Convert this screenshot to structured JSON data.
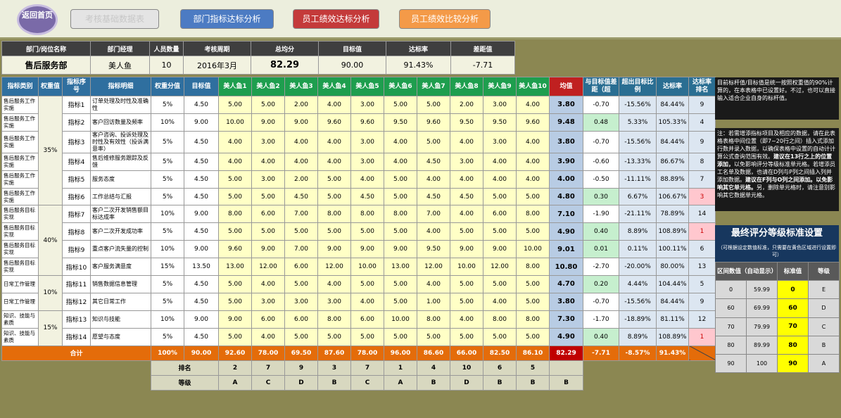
{
  "nav": {
    "home": "返回首页",
    "btn_base": "考核基础数据表",
    "btn_dept": "部门指标达标分析",
    "btn_staff": "员工绩效达标分析",
    "btn_compare": "员工绩效比较分析"
  },
  "summary": {
    "headers": [
      "部门/岗位名称",
      "部门经理",
      "人员数量",
      "考核周期",
      "总均分",
      "目标值",
      "达标率",
      "差距值"
    ],
    "values": [
      "售后服务部",
      "美人鱼",
      "10",
      "2016年3月",
      "82.29",
      "90.00",
      "91.43%",
      "-7.71"
    ]
  },
  "table": {
    "headers": [
      "指标类别",
      "权重值",
      "指标序号",
      "指标明细",
      "权重分值",
      "目标值",
      "美人鱼1",
      "美人鱼2",
      "美人鱼3",
      "美人鱼4",
      "美人鱼5",
      "美人鱼6",
      "美人鱼7",
      "美人鱼8",
      "美人鱼9",
      "美人鱼10",
      "均值",
      "与目标值差距（超",
      "超出目标比例",
      "达标率",
      "达标率排名"
    ],
    "rows": [
      {
        "cat": "售后服务工作实施",
        "no": "指标1",
        "detail": "订单处理及时性及准确性",
        "ws": "5%",
        "target": "4.50",
        "scores": [
          "5.00",
          "5.00",
          "2.00",
          "4.00",
          "3.00",
          "5.00",
          "5.00",
          "2.00",
          "3.00",
          "4.00"
        ],
        "avg": "3.80",
        "gap": "-0.70",
        "exceed": "-15.56%",
        "rate": "84.44%",
        "rank": "9"
      },
      {
        "cat": "售后服务工作实施",
        "no": "指标2",
        "detail": "客户回访数量及频率",
        "ws": "10%",
        "target": "9.00",
        "scores": [
          "10.00",
          "9.00",
          "9.00",
          "9.60",
          "9.60",
          "9.50",
          "9.60",
          "9.50",
          "9.50",
          "9.60"
        ],
        "avg": "9.48",
        "gap": "0.48",
        "exceed": "5.33%",
        "rate": "105.33%",
        "rank": "4"
      },
      {
        "cat": "售后服务工作实施",
        "no": "指标3",
        "detail": "客户咨询、投诉处理及时性及有效性（投诉满意率）",
        "ws": "5%",
        "target": "4.50",
        "scores": [
          "4.00",
          "3.00",
          "4.00",
          "4.00",
          "3.00",
          "4.00",
          "5.00",
          "4.00",
          "3.00",
          "4.00"
        ],
        "avg": "3.80",
        "gap": "-0.70",
        "exceed": "-15.56%",
        "rate": "84.44%",
        "rank": "9"
      },
      {
        "cat": "售后服务工作实施",
        "no": "指标4",
        "detail": "售后维修服务跟踪及反馈",
        "ws": "5%",
        "target": "4.50",
        "scores": [
          "4.00",
          "4.00",
          "4.00",
          "4.00",
          "3.00",
          "4.00",
          "4.50",
          "3.00",
          "4.00",
          "4.00"
        ],
        "avg": "3.90",
        "gap": "-0.60",
        "exceed": "-13.33%",
        "rate": "86.67%",
        "rank": "8"
      },
      {
        "cat": "售后服务工作实施",
        "no": "指标5",
        "detail": "服务态度",
        "ws": "5%",
        "target": "4.50",
        "scores": [
          "5.00",
          "3.00",
          "2.00",
          "5.00",
          "4.00",
          "5.00",
          "4.00",
          "4.00",
          "4.00",
          "4.00"
        ],
        "avg": "4.00",
        "gap": "-0.50",
        "exceed": "-11.11%",
        "rate": "88.89%",
        "rank": "7"
      },
      {
        "cat": "售后服务工作实施",
        "no": "指标6",
        "detail": "工作总结与汇报",
        "ws": "5%",
        "target": "4.50",
        "scores": [
          "5.00",
          "5.00",
          "4.50",
          "5.00",
          "4.50",
          "5.00",
          "4.50",
          "4.50",
          "5.00",
          "5.00"
        ],
        "avg": "4.80",
        "gap": "0.30",
        "exceed": "6.67%",
        "rate": "106.67%",
        "rank": "3"
      },
      {
        "cat": "售后服务目标实现",
        "no": "指标7",
        "detail": "客户二次开发销售额目标达成率",
        "ws": "10%",
        "target": "9.00",
        "scores": [
          "8.00",
          "6.00",
          "7.00",
          "8.00",
          "8.00",
          "8.00",
          "7.00",
          "4.00",
          "6.00",
          "8.00"
        ],
        "avg": "7.10",
        "gap": "-1.90",
        "exceed": "-21.11%",
        "rate": "78.89%",
        "rank": "14"
      },
      {
        "cat": "售后服务目标实现",
        "no": "指标8",
        "detail": "客户二次开发成功率",
        "ws": "5%",
        "target": "4.50",
        "scores": [
          "5.00",
          "5.00",
          "5.00",
          "5.00",
          "5.00",
          "5.00",
          "4.00",
          "5.00",
          "5.00",
          "5.00"
        ],
        "avg": "4.90",
        "gap": "0.40",
        "exceed": "8.89%",
        "rate": "108.89%",
        "rank": "1"
      },
      {
        "cat": "售后服务目标实现",
        "no": "指标9",
        "detail": "重点客户流失量的控制",
        "ws": "10%",
        "target": "9.00",
        "scores": [
          "9.60",
          "9.00",
          "7.00",
          "9.00",
          "9.00",
          "9.00",
          "9.50",
          "9.00",
          "9.00",
          "10.00"
        ],
        "avg": "9.01",
        "gap": "0.01",
        "exceed": "0.11%",
        "rate": "100.11%",
        "rank": "6"
      },
      {
        "cat": "售后服务目标实现",
        "no": "指标10",
        "detail": "客户服务满意度",
        "ws": "15%",
        "target": "13.50",
        "scores": [
          "13.00",
          "12.00",
          "6.00",
          "12.00",
          "10.00",
          "13.00",
          "12.00",
          "10.00",
          "12.00",
          "8.00"
        ],
        "avg": "10.80",
        "gap": "-2.70",
        "exceed": "-20.00%",
        "rate": "80.00%",
        "rank": "13"
      },
      {
        "cat": "日常工作管理",
        "no": "指标11",
        "detail": "销售数据信息管理",
        "ws": "5%",
        "target": "4.50",
        "scores": [
          "5.00",
          "4.00",
          "5.00",
          "4.00",
          "5.00",
          "5.00",
          "4.00",
          "5.00",
          "5.00",
          "5.00"
        ],
        "avg": "4.70",
        "gap": "0.20",
        "exceed": "4.44%",
        "rate": "104.44%",
        "rank": "5"
      },
      {
        "cat": "日常工作管理",
        "no": "指标12",
        "detail": "其它日常工作",
        "ws": "5%",
        "target": "4.50",
        "scores": [
          "5.00",
          "3.00",
          "3.00",
          "3.00",
          "4.00",
          "5.00",
          "1.00",
          "5.00",
          "4.00",
          "5.00"
        ],
        "avg": "3.80",
        "gap": "-0.70",
        "exceed": "-15.56%",
        "rate": "84.44%",
        "rank": "9"
      },
      {
        "cat": "知识、技能与素质",
        "no": "指标13",
        "detail": "知识与技能",
        "ws": "10%",
        "target": "9.00",
        "scores": [
          "9.00",
          "6.00",
          "6.00",
          "8.00",
          "6.00",
          "10.00",
          "8.00",
          "4.00",
          "8.00",
          "8.00"
        ],
        "avg": "7.30",
        "gap": "-1.70",
        "exceed": "-18.89%",
        "rate": "81.11%",
        "rank": "12"
      },
      {
        "cat": "知识、技能与素质",
        "no": "指标14",
        "detail": "愿望与态度",
        "ws": "5%",
        "target": "4.50",
        "scores": [
          "5.00",
          "4.00",
          "5.00",
          "5.00",
          "5.00",
          "5.00",
          "5.00",
          "5.00",
          "5.00",
          "5.00"
        ],
        "avg": "4.90",
        "gap": "0.40",
        "exceed": "8.89%",
        "rate": "108.89%",
        "rank": "1"
      }
    ],
    "group_weights": [
      "35%",
      "40%",
      "10%",
      "15%"
    ],
    "total": {
      "label": "合计",
      "ws": "100%",
      "target": "90.00",
      "scores": [
        "92.60",
        "78.00",
        "69.50",
        "87.60",
        "78.00",
        "96.00",
        "86.60",
        "66.00",
        "82.50",
        "86.10"
      ],
      "avg": "82.29",
      "gap": "-7.71",
      "exceed": "-8.57%",
      "rate": "91.43%"
    },
    "rank_label": "排名",
    "ranks": [
      "2",
      "7",
      "9",
      "3",
      "7",
      "1",
      "4",
      "10",
      "6",
      "5"
    ],
    "grade_label": "等级",
    "grades": [
      "A",
      "C",
      "D",
      "B",
      "C",
      "A",
      "B",
      "D",
      "B",
      "B"
    ],
    "avg_grade": "B"
  },
  "notes": {
    "note1": "目前标杆值/目标值是统一按照权重值的90%计算的，在本表格中已设置好。不过，也可以直接输入适合企业自身的标杆值。",
    "note2_a": "注：若需增添指标项目及相应的数据，请在此表格表格中间位置（即7~20行之间）插入式添加行数并录入数据，以确保表格中设置的自动计计算公式查询范围有效。",
    "note2_b": "建议在13行之上的位置添加，",
    "note2_c": "以免影响评分等级标准单元格。若增添员工名单及数据，也请在D列与P列之间插入列并添加数据。",
    "note2_d": "建议在F列与O列之间添加。以免影响其它单元格。",
    "note2_e": "另，删除单元格时，请注意别影响其它数据单元格。"
  },
  "grade_std": {
    "title": "最终评分等级标准设置",
    "subtitle": "（可根据设定数值标准，只需要在黄色区域进行设置即可）",
    "headers": [
      "区间数值（自动显示）",
      "标准值",
      "等级"
    ],
    "rows": [
      {
        "lo": "0",
        "hi": "59.99",
        "std": "0",
        "grade": "E"
      },
      {
        "lo": "60",
        "hi": "69.99",
        "std": "60",
        "grade": "D"
      },
      {
        "lo": "70",
        "hi": "79.99",
        "std": "70",
        "grade": "C"
      },
      {
        "lo": "80",
        "hi": "89.99",
        "std": "80",
        "grade": "B"
      },
      {
        "lo": "90",
        "hi": "100",
        "std": "90",
        "grade": "A"
      }
    ]
  }
}
